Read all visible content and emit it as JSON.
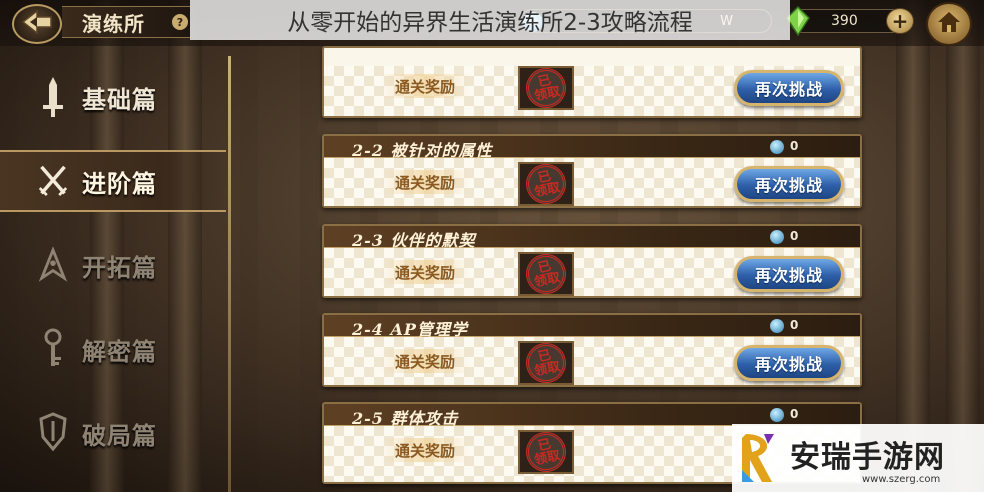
{
  "header": {
    "section_title": "演练所",
    "help_glyph": "?",
    "overlay_title": "从零开始的异界生活演练所2-3攻略流程",
    "resource_1_value": "W",
    "resource_2_value": "390",
    "plus_glyph": "+"
  },
  "sidebar": {
    "items": [
      {
        "label": "基础篇",
        "icon": "sword-icon",
        "active": false,
        "dim": false
      },
      {
        "label": "进阶篇",
        "icon": "crossed-swords-icon",
        "active": true,
        "dim": false
      },
      {
        "label": "开拓篇",
        "icon": "compass-icon",
        "active": false,
        "dim": true
      },
      {
        "label": "解密篇",
        "icon": "key-icon",
        "active": false,
        "dim": true
      },
      {
        "label": "破局篇",
        "icon": "shield-icon",
        "active": false,
        "dim": true
      }
    ]
  },
  "stages": [
    {
      "name": "",
      "reward_label": "通关奖励",
      "stamp": "已领取",
      "gem_count": "",
      "button": "再次挑战"
    },
    {
      "name": "2-2 被针对的属性",
      "reward_label": "通关奖励",
      "stamp": "已领取",
      "gem_count": "0",
      "button": "再次挑战"
    },
    {
      "name": "2-3 伙伴的默契",
      "reward_label": "通关奖励",
      "stamp": "已领取",
      "gem_count": "0",
      "button": "再次挑战"
    },
    {
      "name": "2-4 AP管理学",
      "reward_label": "通关奖励",
      "stamp": "已领取",
      "gem_count": "0",
      "button": "再次挑战"
    },
    {
      "name": "2-5 群体攻击",
      "reward_label": "通关奖励",
      "stamp": "已领取",
      "gem_count": "0",
      "button": ""
    }
  ],
  "site_badge": {
    "name": "安瑞手游网",
    "url": "www.szerg.com"
  },
  "colors": {
    "accent_gold": "#b99862",
    "button_blue": "#2d5fa8",
    "stamp_red": "#c92a22"
  }
}
